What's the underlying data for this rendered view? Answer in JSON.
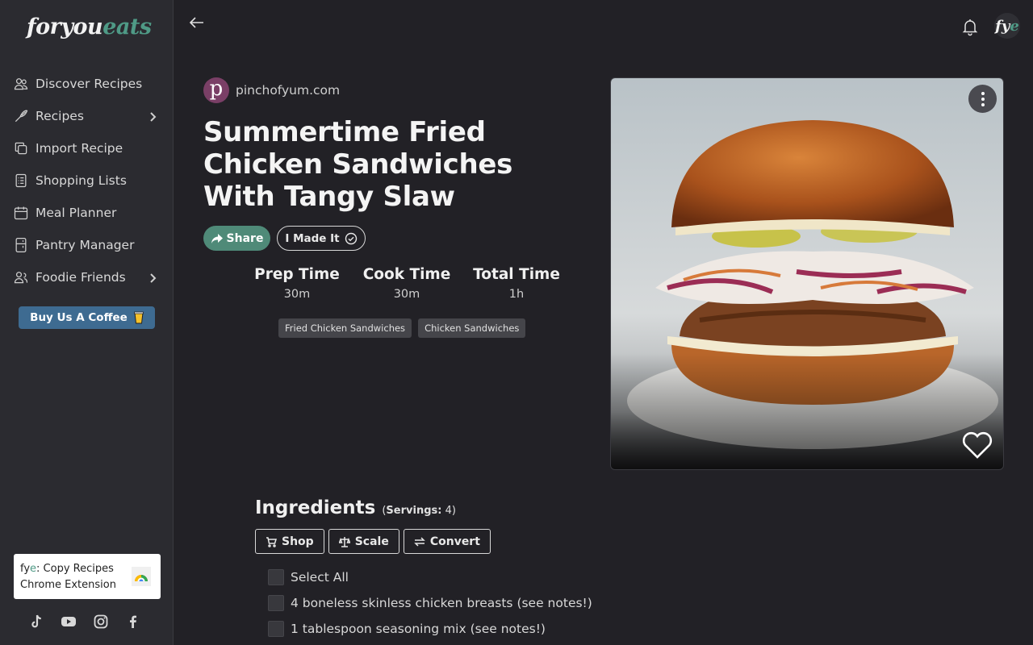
{
  "brand": {
    "logo_part1": "foryou",
    "logo_part2": "eats",
    "avatar_part1": "fy",
    "avatar_part2": "e"
  },
  "sidebar": {
    "items": [
      {
        "label": "Discover Recipes",
        "icon": "users-icon",
        "has_chevron": false
      },
      {
        "label": "Recipes",
        "icon": "whisk-icon",
        "has_chevron": true
      },
      {
        "label": "Import Recipe",
        "icon": "copy-icon",
        "has_chevron": false
      },
      {
        "label": "Shopping Lists",
        "icon": "checklist-icon",
        "has_chevron": false
      },
      {
        "label": "Meal Planner",
        "icon": "calendar-icon",
        "has_chevron": false
      },
      {
        "label": "Pantry Manager",
        "icon": "fridge-icon",
        "has_chevron": false
      },
      {
        "label": "Foodie Friends",
        "icon": "friends-icon",
        "has_chevron": true
      }
    ],
    "coffee_button": "Buy Us A Coffee",
    "extension_card": {
      "line1_prefix": "fy",
      "line1_accent": "e",
      "line1_rest": ": Copy Recipes",
      "line2": "Chrome Extension"
    },
    "socials": [
      "tiktok-icon",
      "youtube-icon",
      "instagram-icon",
      "facebook-icon"
    ]
  },
  "recipe": {
    "source_letter": "p",
    "source": "pinchofyum.com",
    "title": "Summertime Fried Chicken Sandwiches With Tangy Slaw",
    "share_label": "Share",
    "made_it_label": "I Made It",
    "times": [
      {
        "label": "Prep Time",
        "value": "30m"
      },
      {
        "label": "Cook Time",
        "value": "30m"
      },
      {
        "label": "Total Time",
        "value": "1h"
      }
    ],
    "tags": [
      "Fried Chicken Sandwiches",
      "Chicken Sandwiches"
    ]
  },
  "ingredients": {
    "heading": "Ingredients",
    "servings_label": "Servings:",
    "servings_value": "4",
    "buttons": [
      "Shop",
      "Scale",
      "Convert"
    ],
    "select_all": "Select All",
    "items": [
      "4 boneless skinless chicken breasts (see notes!)",
      "1 tablespoon seasoning mix (see notes!)"
    ]
  },
  "colors": {
    "accent": "#4f9a86",
    "sidebar_bg": "#2b2b30",
    "page_bg": "#222126",
    "coffee": "#3e6b91"
  }
}
